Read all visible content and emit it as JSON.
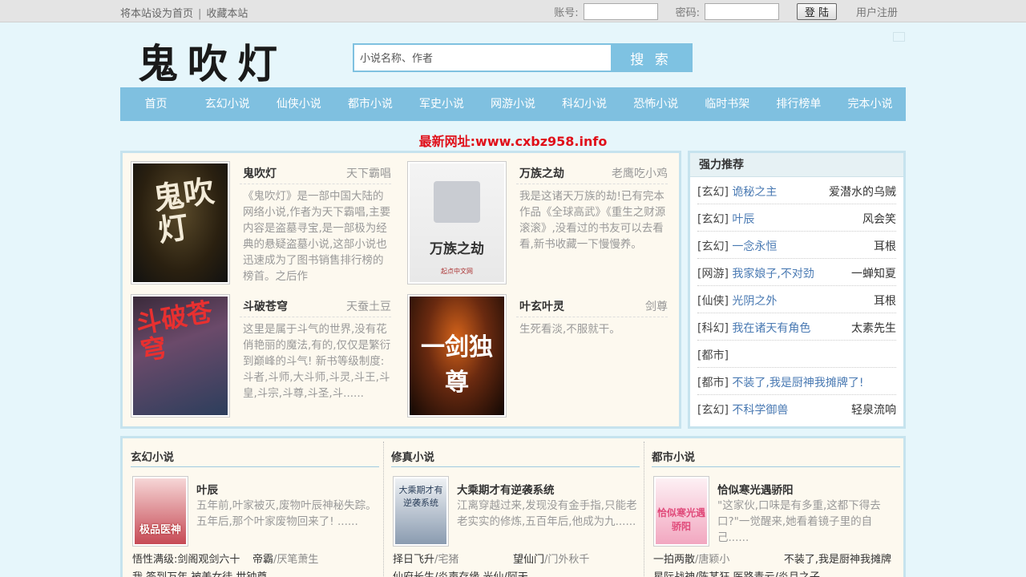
{
  "topbar": {
    "set_home": "将本站设为首页",
    "separator": "|",
    "bookmark": "收藏本站",
    "account_label": "账号:",
    "password_label": "密码:",
    "login_button": "登 陆",
    "register": "用户注册"
  },
  "header": {
    "logo": "鬼吹灯",
    "search_placeholder": "小说名称、作者",
    "search_button": "搜 索"
  },
  "nav": [
    "首页",
    "玄幻小说",
    "仙侠小说",
    "都市小说",
    "军史小说",
    "网游小说",
    "科幻小说",
    "恐怖小说",
    "临时书架",
    "排行榜单",
    "完本小说"
  ],
  "notice": "最新网址:www.cxbz958.info",
  "featured": [
    {
      "title": "鬼吹灯",
      "author": "天下霸唱",
      "cover_text": "鬼吹灯",
      "desc": "《鬼吹灯》是一部中国大陆的网络小说,作者为天下霸唱,主要内容是盗墓寻宝,是一部极为经典的悬疑盗墓小说,这部小说也迅速成为了图书销售排行榜的榜首。之后作"
    },
    {
      "title": "万族之劫",
      "author": "老鹰吃小鸡",
      "cover_text": "万族之劫",
      "cover_sub": "起点中文网",
      "desc": "我是这诸天万族的劫!已有完本作品《全球高武》《重生之财源滚滚》,没看过的书友可以去看看,新书收藏一下慢慢养。"
    },
    {
      "title": "斗破苍穹",
      "author": "天蚕土豆",
      "cover_text": "斗破苍穹",
      "desc": "这里是属于斗气的世界,没有花俏艳丽的魔法,有的,仅仅是繁衍到巅峰的斗气!  新书等级制度:斗者,斗师,大斗师,斗灵,斗王,斗皇,斗宗,斗尊,斗圣,斗......"
    },
    {
      "title": "叶玄叶灵",
      "author": "剑尊",
      "cover_text": "一剑独尊",
      "desc": "生死看淡,不服就干。"
    }
  ],
  "recommend": {
    "heading": "强力推荐",
    "items": [
      {
        "cat": "[玄幻]",
        "name": "诡秘之主",
        "author": "爱潜水的乌贼"
      },
      {
        "cat": "[玄幻]",
        "name": "叶辰",
        "author": "风会笑"
      },
      {
        "cat": "[玄幻]",
        "name": "一念永恒",
        "author": "耳根"
      },
      {
        "cat": "[网游]",
        "name": "我家娘子,不对劲",
        "author": "一蝉知夏"
      },
      {
        "cat": "[仙侠]",
        "name": "光阴之外",
        "author": "耳根"
      },
      {
        "cat": "[科幻]",
        "name": "我在诸天有角色",
        "author": "太素先生"
      },
      {
        "cat": "[都市]",
        "name": "",
        "author": ""
      },
      {
        "cat": "[都市]",
        "name": "不装了,我是厨神我摊牌了!",
        "author": ""
      },
      {
        "cat": "[玄幻]",
        "name": "不科学御兽",
        "author": "轻泉流响"
      }
    ]
  },
  "categories": [
    {
      "heading": "玄幻小说",
      "cover_text": "极品医神",
      "title": "叶辰",
      "desc": "五年前,叶家被灭,废物叶辰神秘失踪。五年后,那个叶家废物回来了! ......",
      "line1_left": "悟性满级:剑阁观剑六十",
      "line1_right": "帝霸",
      "line1_right_author": "/厌笔萧生",
      "line2": "我,签到万年,被美女徒    世钟尊  ——"
    },
    {
      "heading": "修真小说",
      "cover_text": "大乘期才有逆袭系统",
      "title": "大乘期才有逆袭系统",
      "desc": "江离穿越过来,发现没有金手指,只能老老实实的修炼,五百年后,他成为九......",
      "line1_left": "择日飞升",
      "line1_left_author": "/宅猪",
      "line1_right": "望仙门",
      "line1_right_author": "/门外秋千",
      "line2": "仙府长生/炎声存缘    光仙/阿天"
    },
    {
      "heading": "都市小说",
      "cover_text": "恰似寒光遇骄阳",
      "title": "恰似寒光遇骄阳",
      "desc": "\"这家伙,口味是有多重,这都下得去口?\"一觉醒来,她看着镜子里的自己......",
      "line1_left": "一拍两散",
      "line1_left_author": "/唐颖小",
      "line1_right": "不装了,我是厨神我摊牌",
      "line2": "星际战神/陈某狂    医路青云/炎月之子"
    }
  ]
}
